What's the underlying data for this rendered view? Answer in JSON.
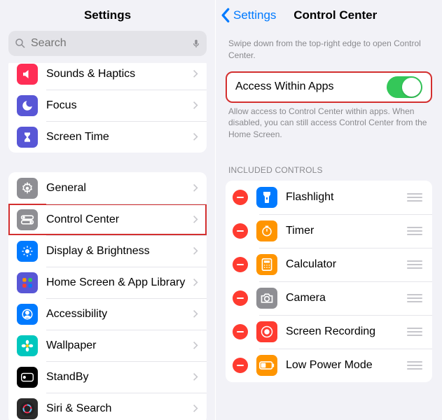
{
  "left": {
    "title": "Settings",
    "search_placeholder": "Search",
    "group1": [
      {
        "label": "Sounds & Haptics",
        "name": "sounds-haptics",
        "color": "#ff2d55",
        "glyph": "speaker"
      },
      {
        "label": "Focus",
        "name": "focus",
        "color": "#5856d6",
        "glyph": "moon"
      },
      {
        "label": "Screen Time",
        "name": "screen-time",
        "color": "#5856d6",
        "glyph": "hourglass"
      }
    ],
    "group2": [
      {
        "label": "General",
        "name": "general",
        "color": "#8e8e93",
        "glyph": "gear"
      },
      {
        "label": "Control Center",
        "name": "control-center",
        "color": "#8e8e93",
        "glyph": "switches",
        "highlight": true
      },
      {
        "label": "Display & Brightness",
        "name": "display-brightness",
        "color": "#007aff",
        "glyph": "sun"
      },
      {
        "label": "Home Screen & App Library",
        "name": "home-screen",
        "color": "#5856d6",
        "glyph": "grid"
      },
      {
        "label": "Accessibility",
        "name": "accessibility",
        "color": "#007aff",
        "glyph": "person"
      },
      {
        "label": "Wallpaper",
        "name": "wallpaper",
        "color": "#00c7be",
        "glyph": "flower"
      },
      {
        "label": "StandBy",
        "name": "standby",
        "color": "#000000",
        "glyph": "standby"
      },
      {
        "label": "Siri & Search",
        "name": "siri-search",
        "color": "#2b2b2b",
        "glyph": "siri"
      }
    ]
  },
  "right": {
    "back_label": "Settings",
    "title": "Control Center",
    "intro": "Swipe down from the top-right edge to open Control Center.",
    "toggle_label": "Access Within Apps",
    "toggle_on": true,
    "toggle_help": "Allow access to Control Center within apps. When disabled, you can still access Control Center from the Home Screen.",
    "included_header": "Included Controls",
    "included": [
      {
        "label": "Flashlight",
        "name": "flashlight",
        "color": "#007aff",
        "glyph": "flashlight"
      },
      {
        "label": "Timer",
        "name": "timer",
        "color": "#ff9500",
        "glyph": "timer"
      },
      {
        "label": "Calculator",
        "name": "calculator",
        "color": "#ff9500",
        "glyph": "calc"
      },
      {
        "label": "Camera",
        "name": "camera",
        "color": "#8e8e93",
        "glyph": "camera"
      },
      {
        "label": "Screen Recording",
        "name": "screen-recording",
        "color": "#ff3b30",
        "glyph": "record"
      },
      {
        "label": "Low Power Mode",
        "name": "low-power",
        "color": "#ff9500",
        "glyph": "battery"
      }
    ]
  }
}
